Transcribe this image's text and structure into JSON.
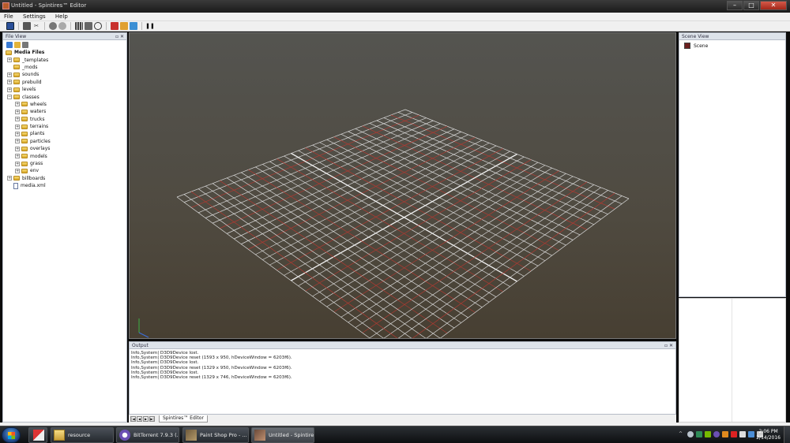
{
  "window": {
    "title": "Untitled - Spintires™ Editor",
    "minimize": "–",
    "maximize": "□",
    "close": "✕"
  },
  "menu": [
    "File",
    "Settings",
    "Help"
  ],
  "toolbar": {
    "icons": [
      "save-icon",
      "open-icon",
      "cut-icon",
      "brush-icon",
      "road-icon",
      "books-icon",
      "layers-icon",
      "clock-icon",
      "tools-icon",
      "terrain-icon",
      "copy-icon",
      "pause-icon"
    ]
  },
  "file_view": {
    "title": "File View",
    "header_buttons": "▫ ✕",
    "root": "Media Files",
    "items": [
      {
        "label": "_templates",
        "depth": 1,
        "expandable": true,
        "type": "folder"
      },
      {
        "label": "_mods",
        "depth": 1,
        "expandable": false,
        "type": "folder"
      },
      {
        "label": "sounds",
        "depth": 1,
        "expandable": true,
        "type": "folder"
      },
      {
        "label": "prebuild",
        "depth": 1,
        "expandable": true,
        "type": "folder"
      },
      {
        "label": "levels",
        "depth": 1,
        "expandable": true,
        "type": "folder"
      },
      {
        "label": "classes",
        "depth": 1,
        "expandable": true,
        "expanded": true,
        "type": "folder"
      },
      {
        "label": "wheels",
        "depth": 2,
        "expandable": true,
        "type": "folder"
      },
      {
        "label": "waters",
        "depth": 2,
        "expandable": true,
        "type": "folder"
      },
      {
        "label": "trucks",
        "depth": 2,
        "expandable": true,
        "type": "folder"
      },
      {
        "label": "terrains",
        "depth": 2,
        "expandable": true,
        "type": "folder"
      },
      {
        "label": "plants",
        "depth": 2,
        "expandable": true,
        "type": "folder"
      },
      {
        "label": "particles",
        "depth": 2,
        "expandable": true,
        "type": "folder"
      },
      {
        "label": "overlays",
        "depth": 2,
        "expandable": true,
        "type": "folder"
      },
      {
        "label": "models",
        "depth": 2,
        "expandable": true,
        "type": "folder"
      },
      {
        "label": "grass",
        "depth": 2,
        "expandable": true,
        "type": "folder"
      },
      {
        "label": "env",
        "depth": 2,
        "expandable": true,
        "type": "folder"
      },
      {
        "label": "billboards",
        "depth": 1,
        "expandable": true,
        "type": "folder"
      },
      {
        "label": "media.xml",
        "depth": 1,
        "expandable": false,
        "type": "file"
      }
    ]
  },
  "scene_view": {
    "title": "Scene View",
    "root": "Scene"
  },
  "output": {
    "title": "Output",
    "lines": [
      "Info,System| D3D9Device lost.",
      "Info,System| D3D9Device reset (1593 x 950, hDeviceWindow = 6203f6).",
      "Info,System| D3D9Device lost.",
      "Info,System| D3D9Device reset (1329 x 950, hDeviceWindow = 6203f6).",
      "Info,System| D3D9Device lost.",
      "Info,System| D3D9Device reset (1329 x 746, hDeviceWindow = 6203f6)."
    ],
    "tab": "Spintires™ Editor"
  },
  "taskbar": {
    "apps": [
      {
        "label": "resource",
        "icon": "folder-icon"
      },
      {
        "label": "BitTorrent 7.9.3  (...",
        "icon": "bittorrent-icon"
      },
      {
        "label": "Paint Shop Pro - ...",
        "icon": "paintshop-icon"
      },
      {
        "label": "Untitled - Spintire...",
        "icon": "spintires-icon",
        "active": true
      }
    ],
    "time": "2:06 PM",
    "date": "2/14/2016"
  },
  "colors": {
    "grid_white": "#d9d9d9",
    "grid_red": "#b03a32",
    "viewport_top": "#545450"
  }
}
